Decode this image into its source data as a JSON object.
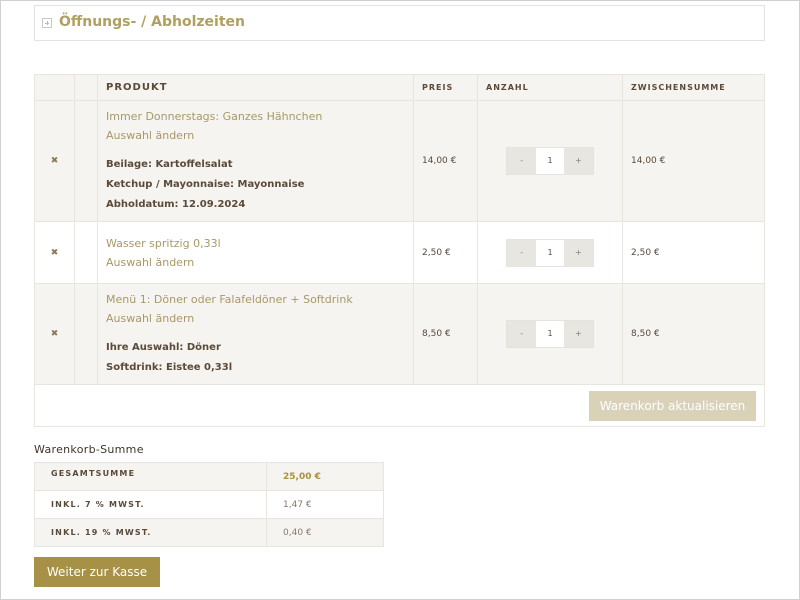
{
  "accordion": {
    "title": "Öffnungs- / Abholzeiten",
    "icon": "plus-square-icon"
  },
  "cart": {
    "headers": {
      "product": "PRODUKT",
      "price": "PREIS",
      "quantity": "ANZAHL",
      "subtotal": "ZWISCHENSUMME"
    },
    "items": [
      {
        "name": "Immer Donnerstags: Ganzes Hähnchen",
        "change_label": "Auswahl ändern",
        "meta": [
          {
            "label": "Beilage:",
            "value": "Kartoffelsalat"
          },
          {
            "label": "Ketchup / Mayonnaise:",
            "value": "Mayonnaise"
          },
          {
            "label": "Abholdatum:",
            "value": "12.09.2024"
          }
        ],
        "price": "14,00 €",
        "qty_minus": "-",
        "qty": "1",
        "qty_plus": "+",
        "subtotal": "14,00 €"
      },
      {
        "name": "Wasser spritzig 0,33l",
        "change_label": "Auswahl ändern",
        "meta": [],
        "price": "2,50 €",
        "qty_minus": "-",
        "qty": "1",
        "qty_plus": "+",
        "subtotal": "2,50 €"
      },
      {
        "name": "Menü 1: Döner oder Falafeldöner + Softdrink",
        "change_label": "Auswahl ändern",
        "meta": [
          {
            "label": "Ihre Auswahl:",
            "value": "Döner"
          },
          {
            "label": "Softdrink:",
            "value": "Eistee 0,33l"
          }
        ],
        "price": "8,50 €",
        "qty_minus": "-",
        "qty": "1",
        "qty_plus": "+",
        "subtotal": "8,50 €"
      }
    ],
    "remove_icon": "remove-x-icon",
    "remove_glyph": "✖",
    "update_label": "Warenkorb aktualisieren"
  },
  "totals": {
    "title": "Warenkorb-Summe",
    "rows": [
      {
        "label": "GESAMTSUMME",
        "value": "25,00 €"
      },
      {
        "label": "INKL. 7 % MWST.",
        "value": "1,47 €"
      },
      {
        "label": "INKL. 19 % MWST.",
        "value": "0,40 €"
      }
    ]
  },
  "checkout_label": "Weiter zur Kasse",
  "colors": {
    "accent": "#a69146",
    "link": "#a89868",
    "update_button": "#d9d2b8",
    "row_alt": "#f6f4f0"
  }
}
